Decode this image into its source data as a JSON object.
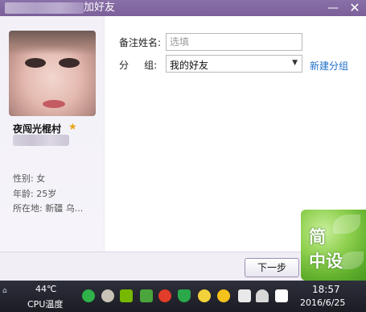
{
  "window": {
    "title": "加好友",
    "min_glyph": "—",
    "close_glyph": "✕"
  },
  "profile": {
    "nickname": "夜闯光棍村",
    "gender": "性别: 女",
    "age": "年龄: 25岁",
    "location": "所在地: 新疆  乌..."
  },
  "form": {
    "remark_label": "备注姓名:",
    "remark_placeholder": "选填",
    "remark_value": "",
    "group_label": "分     组:",
    "group_value": "我的好友",
    "new_group_link": "新建分组"
  },
  "actions": {
    "next_label": "下一步"
  },
  "logo": {
    "line1": "简",
    "line2": "中设"
  },
  "taskbar": {
    "cpu_temp": "44℃",
    "cpu_label": "CPU温度",
    "tray_icons": [
      "wechat-icon",
      "people-icon",
      "nvidia-icon",
      "network-icon",
      "music-icon",
      "shield-icon",
      "qq-icon",
      "plus-icon",
      "volume-icon",
      "action-center-icon"
    ],
    "time": "18:57",
    "date": "2016/6/25"
  },
  "colors": {
    "titlebar": "#7a5f99",
    "link": "#1f6fc8",
    "star": "#e8a41a",
    "taskbar": "#1b1c24"
  }
}
